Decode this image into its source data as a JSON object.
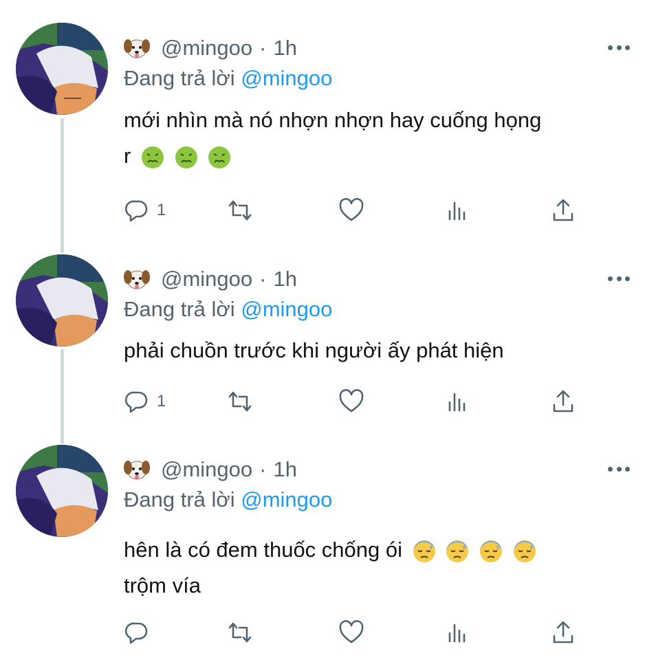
{
  "tweets": [
    {
      "author_emoji": "dog-face",
      "handle": "@mingoo",
      "separator": "·",
      "time": "1h",
      "reply_prefix": "Đang trả lời",
      "reply_to": "@mingoo",
      "text_line1": "mới nhìn mà nó nhợn nhợn hay cuống họng",
      "text_line2": "r",
      "emojis": [
        "nauseated-face",
        "nauseated-face",
        "nauseated-face"
      ],
      "reply_count": "1"
    },
    {
      "author_emoji": "dog-face",
      "handle": "@mingoo",
      "separator": "·",
      "time": "1h",
      "reply_prefix": "Đang trả lời",
      "reply_to": "@mingoo",
      "text_line1": "phải chuồn trước khi người ấy phát hiện",
      "reply_count": "1"
    },
    {
      "author_emoji": "dog-face",
      "handle": "@mingoo",
      "separator": "·",
      "time": "1h",
      "reply_prefix": "Đang trả lời",
      "reply_to": "@mingoo",
      "text_line1": "hên là có đem thuốc chống ói",
      "text_line2": "trộm vía",
      "emojis": [
        "downcast-sweat-face",
        "downcast-sweat-face",
        "downcast-sweat-face",
        "downcast-sweat-face"
      ],
      "reply_count": ""
    }
  ],
  "colors": {
    "text": "#0f1419",
    "secondary": "#536471",
    "link": "#1d9bf0",
    "thread_line": "#cfd9de"
  },
  "icons": [
    "reply-icon",
    "retweet-icon",
    "like-icon",
    "analytics-icon",
    "share-icon",
    "more-icon"
  ]
}
